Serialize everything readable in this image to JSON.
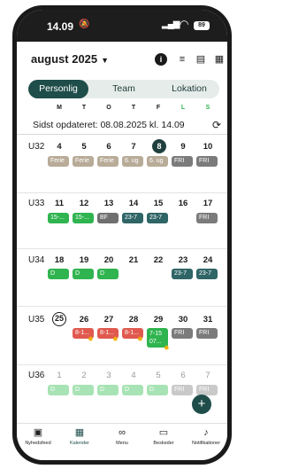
{
  "status_bar": {
    "time": "14.09",
    "battery": "89"
  },
  "header": {
    "month": "august 2025"
  },
  "tabs": [
    "Personlig",
    "Team",
    "Lokation"
  ],
  "weekdays": [
    "M",
    "T",
    "O",
    "T",
    "F",
    "L",
    "S"
  ],
  "updated_text": "Sidst opdateret: 08.08.2025 kl. 14.09",
  "weeks": [
    {
      "label": "U32",
      "days": [
        "4",
        "5",
        "6",
        "7",
        "8",
        "9",
        "10"
      ],
      "events": [
        "Ferie",
        "Ferie",
        "Ferie",
        "6. ug",
        "6. ug",
        "FRI",
        "FRI"
      ]
    },
    {
      "label": "U33",
      "days": [
        "11",
        "12",
        "13",
        "14",
        "15",
        "16",
        "17"
      ],
      "events": [
        "15-...",
        "15-...",
        "BF",
        "23-7",
        "23-7",
        "",
        "FRI"
      ]
    },
    {
      "label": "U34",
      "days": [
        "18",
        "19",
        "20",
        "21",
        "22",
        "23",
        "24"
      ],
      "events": [
        "D",
        "D",
        "D",
        "",
        "",
        "23-7",
        "23-7"
      ]
    },
    {
      "label": "U35",
      "days": [
        "25",
        "26",
        "27",
        "28",
        "29",
        "30",
        "31"
      ],
      "events": [
        "",
        "8-1...",
        "8-1...",
        "8-1...",
        "7-15 07...",
        "FRI",
        "FRI"
      ]
    },
    {
      "label": "U36",
      "days": [
        "1",
        "2",
        "3",
        "4",
        "5",
        "6",
        "7"
      ],
      "events": [
        "D",
        "D",
        "D",
        "D",
        "D",
        "FRI",
        "FRI"
      ]
    }
  ],
  "nav": [
    {
      "label": "Nyhedsfeed",
      "icon": "news-icon"
    },
    {
      "label": "Kalender",
      "icon": "calendar-icon"
    },
    {
      "label": "Menu",
      "icon": "menu-icon"
    },
    {
      "label": "Beskeder",
      "icon": "messages-icon"
    },
    {
      "label": "Notifikationer",
      "icon": "bell-icon"
    }
  ]
}
